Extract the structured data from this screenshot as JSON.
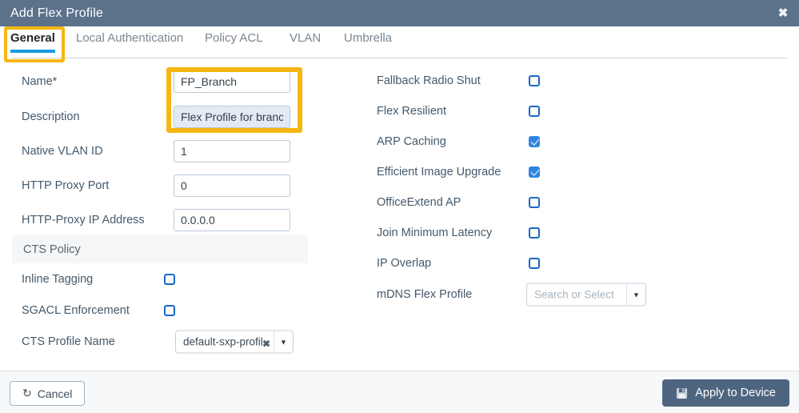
{
  "window": {
    "title": "Add Flex Profile",
    "close_icon": "close-icon"
  },
  "tabs": [
    {
      "label": "General",
      "active": true
    },
    {
      "label": "Local Authentication",
      "active": false
    },
    {
      "label": "Policy ACL",
      "active": false
    },
    {
      "label": "VLAN",
      "active": false
    },
    {
      "label": "Umbrella",
      "active": false
    }
  ],
  "left_column": {
    "fields": [
      {
        "label": "Name*",
        "value": "FP_Branch",
        "focused": false
      },
      {
        "label": "Description",
        "value": "Flex Profile for branches",
        "focused": true
      },
      {
        "label": "Native VLAN ID",
        "value": "1",
        "focused": false
      },
      {
        "label": "HTTP Proxy Port",
        "value": "0",
        "focused": false
      },
      {
        "label": "HTTP-Proxy IP Address",
        "value": "0.0.0.0",
        "focused": false
      }
    ],
    "section": {
      "title": "CTS Policy"
    },
    "checkboxes": [
      {
        "label": "Inline Tagging",
        "checked": false
      },
      {
        "label": "SGACL Enforcement",
        "checked": false
      }
    ],
    "cts_profile": {
      "label": "CTS Profile Name",
      "value": "default-sxp-profile",
      "clear_icon": "clear-x-icon",
      "arrow_icon": "chevron-down-icon"
    }
  },
  "right_column": {
    "checkboxes": [
      {
        "label": "Fallback Radio Shut",
        "checked": false
      },
      {
        "label": "Flex Resilient",
        "checked": false
      },
      {
        "label": "ARP Caching",
        "checked": true
      },
      {
        "label": "Efficient Image Upgrade",
        "checked": true
      },
      {
        "label": "OfficeExtend AP",
        "checked": false
      },
      {
        "label": "Join Minimum Latency",
        "checked": false
      },
      {
        "label": "IP Overlap",
        "checked": false
      }
    ],
    "mdns_profile": {
      "label": "mDNS Flex Profile",
      "value": "",
      "placeholder": "Search or Select",
      "arrow_icon": "chevron-down-icon"
    }
  },
  "footer": {
    "cancel_label": "Cancel",
    "cancel_icon": "undo-icon",
    "apply_label": "Apply to Device",
    "apply_icon": "save-floppy-icon"
  },
  "annotations": {
    "highlight_color": "#f5b711",
    "tab_highlight": "General",
    "field_highlight": "Name and Description"
  },
  "colors": {
    "titlebar": "#5c718a",
    "accent_tab_underline": "#1a9ae0",
    "checkbox_blue": "#2f86e0",
    "apply_button": "#4e6580"
  }
}
